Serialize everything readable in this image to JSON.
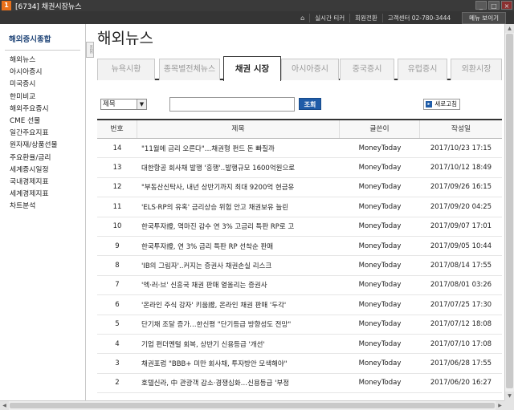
{
  "window": {
    "app_icon": "1",
    "title": "[6734] 채권시장뉴스",
    "buttons": [
      "_",
      "□",
      "×"
    ]
  },
  "topbar": {
    "home_icon": "home-icon",
    "links": [
      "실시간 티커",
      "회원전환",
      "고객센터"
    ],
    "phone": "02-780-3444",
    "menu_button": "메뉴 보이기"
  },
  "sidebar": {
    "heading": "해외증시종합",
    "items": [
      "해외뉴스",
      "아시아증시",
      "미국증시",
      "한미비교",
      "해외주요증시",
      "CME 선물",
      "일간주요지표",
      "원자재/상품선물",
      "주요환율/금리",
      "세계증시일정",
      "국내경제지표",
      "세계경제지표",
      "차트분석"
    ],
    "hide_label": "HIDE"
  },
  "main": {
    "title": "해외뉴스",
    "tabs": [
      "뉴욕시황",
      "종목별전체뉴스",
      "채권 시장",
      "아시아증시",
      "중국증시",
      "유럽증시",
      "외환시장"
    ],
    "active_tab_index": 2,
    "search": {
      "select_value": "제목",
      "input_value": "",
      "search_button": "조회",
      "refresh_button": "새로고침"
    },
    "table": {
      "headers": [
        "번호",
        "제목",
        "글쓴이",
        "작성일"
      ],
      "rows": [
        {
          "num": "14",
          "title": "\"11월에 금리 오른다\"…채권형 펀드 돈 빠질까",
          "writer": "MoneyToday",
          "date": "2017/10/23 17:15"
        },
        {
          "num": "13",
          "title": "대한항공 회사채 발행 '흥행'..발행규모 1600억원으로",
          "writer": "MoneyToday",
          "date": "2017/10/12 18:49"
        },
        {
          "num": "12",
          "title": "\"부동산신탁사, 내년 상반기까지 최대 9200억 현금유",
          "writer": "MoneyToday",
          "date": "2017/09/26 16:15"
        },
        {
          "num": "11",
          "title": "'ELS·RP의 유혹' 금리상승 위험 안고 채권보유 늘린",
          "writer": "MoneyToday",
          "date": "2017/09/20 04:25"
        },
        {
          "num": "10",
          "title": "한국투자證, 역마진 감수 연 3% 고금리 특판 RP로 고",
          "writer": "MoneyToday",
          "date": "2017/09/07 17:01"
        },
        {
          "num": "9",
          "title": "한국투자證, 연 3% 금리 특판 RP 선착순 판매",
          "writer": "MoneyToday",
          "date": "2017/09/05 10:44"
        },
        {
          "num": "8",
          "title": "'IB의 그림자'..커지는 증권사 채권손실 리스크",
          "writer": "MoneyToday",
          "date": "2017/08/14 17:55"
        },
        {
          "num": "7",
          "title": "'엑·러·브' 신흥국 채권 판매 열올리는 증권사",
          "writer": "MoneyToday",
          "date": "2017/08/01 03:26"
        },
        {
          "num": "6",
          "title": "'온라인 주식 강자' 키움證, 온라인 채권 판매 '두각'",
          "writer": "MoneyToday",
          "date": "2017/07/25 17:30"
        },
        {
          "num": "5",
          "title": "단기채 조달 증가…한신평 \"단기등급 방향성도 전망\"",
          "writer": "MoneyToday",
          "date": "2017/07/12 18:08"
        },
        {
          "num": "4",
          "title": "기업 펀더멘털 회복, 상반기 신용등급 '개선'",
          "writer": "MoneyToday",
          "date": "2017/07/10 17:08"
        },
        {
          "num": "3",
          "title": "채권포럼 \"BBB+ 미만 회사채, 투자방안 모색해야\"",
          "writer": "MoneyToday",
          "date": "2017/06/28 17:55"
        },
        {
          "num": "2",
          "title": "호텔신라, 中 관광객 감소·경쟁심화…신용등급 '부정",
          "writer": "MoneyToday",
          "date": "2017/06/20 16:27"
        }
      ]
    }
  }
}
